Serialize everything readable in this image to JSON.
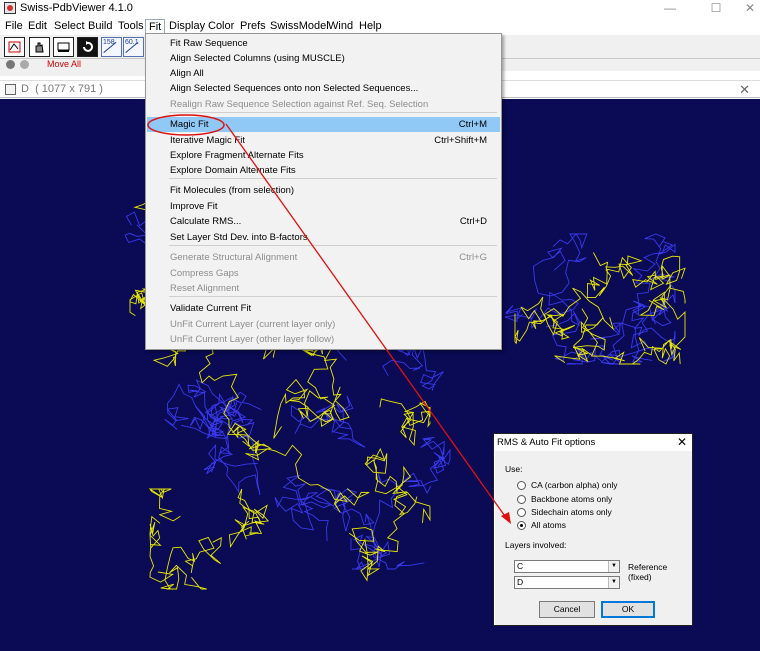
{
  "window": {
    "title": "Swiss-PdbViewer 4.1.0",
    "minimize": "—",
    "maximize": "☐",
    "close": "✕"
  },
  "menubar": [
    "File",
    "Edit",
    "Select",
    "Build",
    "Tools",
    "Fit",
    "Display",
    "Color",
    "Prefs",
    "SwissModel",
    "Wind",
    "Help"
  ],
  "toolbar": {
    "move_all_label": "Move All",
    "angle_label": "158",
    "dist_label": "60.1"
  },
  "inner_window": {
    "title": "D",
    "size": "( 1077 x 791 )",
    "close": "✕"
  },
  "fit_menu": {
    "items": [
      {
        "label": "Fit Raw Sequence",
        "shortcut": "",
        "disabled": false
      },
      {
        "label": "Align Selected Columns (using MUSCLE)",
        "shortcut": "",
        "disabled": false
      },
      {
        "label": "Align All",
        "shortcut": "",
        "disabled": false
      },
      {
        "label": "Align Selected Sequences onto non Selected Sequences...",
        "shortcut": "",
        "disabled": false
      },
      {
        "label": "Realign Raw Sequence Selection against Ref. Seq. Selection",
        "shortcut": "",
        "disabled": true
      },
      {
        "label": "Magic Fit",
        "shortcut": "Ctrl+M",
        "disabled": false,
        "highlighted": true
      },
      {
        "label": "Iterative Magic Fit",
        "shortcut": "Ctrl+Shift+M",
        "disabled": false
      },
      {
        "label": "Explore Fragment Alternate Fits",
        "shortcut": "",
        "disabled": false
      },
      {
        "label": "Explore Domain Alternate Fits",
        "shortcut": "",
        "disabled": false
      },
      {
        "label": "Fit Molecules (from selection)",
        "shortcut": "",
        "disabled": false
      },
      {
        "label": "Improve Fit",
        "shortcut": "",
        "disabled": false
      },
      {
        "label": "Calculate RMS...",
        "shortcut": "Ctrl+D",
        "disabled": false
      },
      {
        "label": "Set Layer Std Dev. into B-factors",
        "shortcut": "",
        "disabled": false
      },
      {
        "label": "Generate Structural Alignment",
        "shortcut": "Ctrl+G",
        "disabled": true
      },
      {
        "label": "Compress Gaps",
        "shortcut": "",
        "disabled": true
      },
      {
        "label": "Reset Alignment",
        "shortcut": "",
        "disabled": true
      },
      {
        "label": "Validate Current Fit",
        "shortcut": "",
        "disabled": false
      },
      {
        "label": "UnFit Current Layer (current layer only)",
        "shortcut": "",
        "disabled": true
      },
      {
        "label": "UnFit Current Layer (other layer follow)",
        "shortcut": "",
        "disabled": true
      }
    ]
  },
  "dialog": {
    "title": "RMS & Auto Fit options",
    "close": "✕",
    "use_label": "Use:",
    "options": [
      {
        "label": "CA (carbon alpha) only",
        "selected": false
      },
      {
        "label": "Backbone atoms only",
        "selected": false
      },
      {
        "label": "Sidechain atoms only",
        "selected": false
      },
      {
        "label": "All atoms",
        "selected": true
      }
    ],
    "layers_label": "Layers involved:",
    "layer1": "C",
    "layer2": "D",
    "reference_label": "Reference (fixed)",
    "cancel": "Cancel",
    "ok": "OK"
  },
  "colors": {
    "viewer_bg": "#0a0a55",
    "layer_c": "#e8e800",
    "layer_d": "#3a3aee",
    "annotation": "#e01010",
    "highlight": "#90c8f6"
  }
}
